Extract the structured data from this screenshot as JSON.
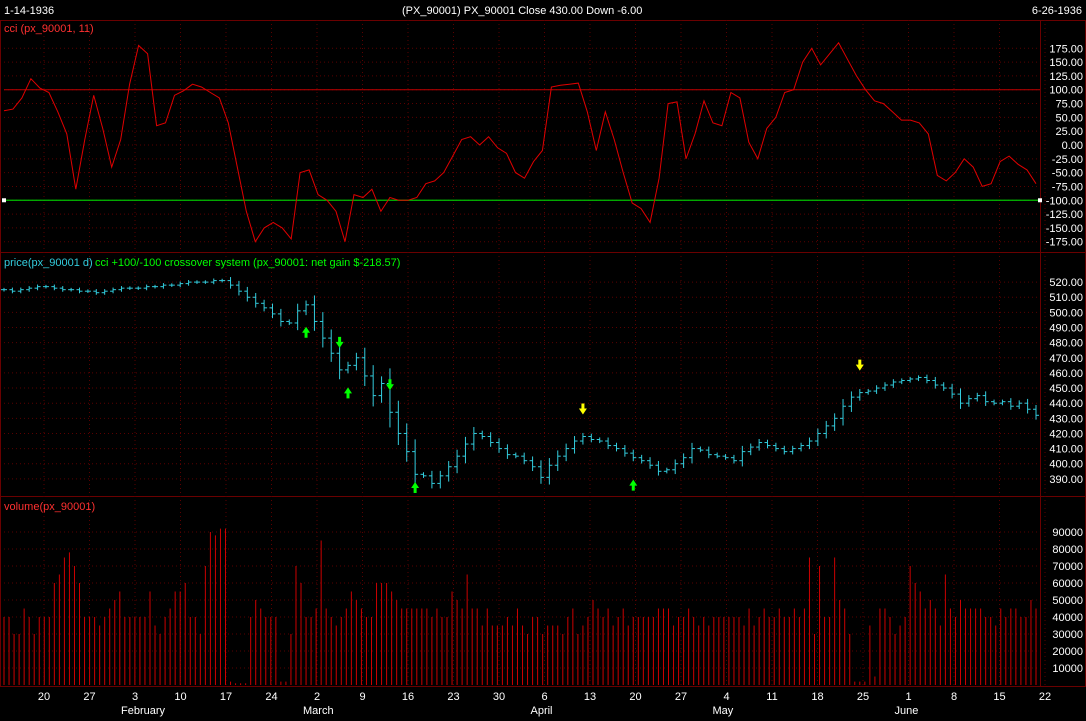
{
  "header": {
    "start_date": "1-14-1936",
    "title": "(PX_90001)  PX_90001   Close 430.00   Down -6.00",
    "end_date": "6-26-1936"
  },
  "colors": {
    "background": "#000000",
    "grid": "#5a0000",
    "cci_line": "#e00000",
    "cci_bands": "#c00000",
    "cci_threshold": "#00c000",
    "price_bars": "#33ccdd",
    "buy_arrow": "#00ff00",
    "sell_arrow": "#ffff00",
    "volume_bars": "#cc0000",
    "axis_text": "#ffffff",
    "cci_title": "#ff3030",
    "price_title": "#33ccdd",
    "system_title": "#00ff00",
    "volume_title": "#ff3030"
  },
  "chart_data": [
    {
      "type": "line",
      "panel": "cci",
      "title": "cci (px_90001, 11)",
      "ylim": [
        -190,
        190
      ],
      "y_ticks": [
        "175.00",
        "150.00",
        "125.00",
        "100.00",
        "75.00",
        "50.00",
        "25.00",
        "0.00",
        "-25.00",
        "-50.00",
        "-75.00",
        "-100.00",
        "-125.00",
        "-150.00",
        "-175.00"
      ],
      "reference_lines": {
        "upper": 100,
        "lower": -100
      },
      "values": [
        62,
        65,
        85,
        120,
        103,
        95,
        60,
        20,
        -80,
        10,
        90,
        30,
        -40,
        10,
        110,
        180,
        165,
        35,
        40,
        90,
        98,
        110,
        105,
        95,
        85,
        40,
        -40,
        -120,
        -175,
        -150,
        -140,
        -150,
        -170,
        -50,
        -45,
        -90,
        -100,
        -120,
        -175,
        -90,
        -95,
        -80,
        -120,
        -95,
        -100,
        -100,
        -95,
        -70,
        -65,
        -50,
        -20,
        10,
        15,
        0,
        15,
        -5,
        -15,
        -50,
        -60,
        -30,
        -10,
        105,
        108,
        110,
        112,
        60,
        -10,
        60,
        10,
        -50,
        -105,
        -115,
        -140,
        -60,
        75,
        78,
        -25,
        20,
        80,
        40,
        35,
        95,
        85,
        5,
        -25,
        30,
        50,
        95,
        100,
        150,
        175,
        145,
        165,
        185,
        155,
        125,
        100,
        80,
        75,
        60,
        45,
        45,
        40,
        20,
        -55,
        -65,
        -50,
        -25,
        -40,
        -75,
        -70,
        -30,
        -20,
        -35,
        -45,
        -70
      ]
    },
    {
      "type": "ohlc",
      "panel": "price",
      "title": "price(px_90001 d)",
      "system_label": "cci +100/-100 crossover system (px_90001: net gain $-218.57)",
      "ylim": [
        380,
        528
      ],
      "y_ticks": [
        "520.00",
        "510.00",
        "500.00",
        "490.00",
        "480.00",
        "470.00",
        "460.00",
        "450.00",
        "440.00",
        "430.00",
        "420.00",
        "410.00",
        "400.00",
        "390.00"
      ],
      "closes": [
        515,
        514,
        515,
        516,
        517,
        517,
        516,
        515,
        515,
        514,
        514,
        513,
        514,
        515,
        516,
        516,
        516,
        517,
        517,
        518,
        518,
        519,
        520,
        520,
        520,
        521,
        521,
        518,
        514,
        510,
        506,
        503,
        499,
        494,
        493,
        501,
        505,
        494,
        483,
        473,
        462,
        465,
        470,
        458,
        445,
        453,
        434,
        420,
        408,
        393,
        392,
        387,
        392,
        398,
        405,
        413,
        420,
        418,
        414,
        410,
        406,
        405,
        402,
        398,
        391,
        399,
        405,
        410,
        415,
        418,
        416,
        415,
        412,
        410,
        407,
        404,
        402,
        399,
        395,
        396,
        400,
        404,
        410,
        409,
        406,
        405,
        404,
        402,
        408,
        411,
        414,
        412,
        410,
        408,
        410,
        412,
        415,
        420,
        425,
        430,
        438,
        444,
        447,
        448,
        450,
        452,
        454,
        455,
        456,
        457,
        455,
        452,
        450,
        446,
        440,
        443,
        445,
        441,
        440,
        441,
        438,
        440,
        436,
        432
      ],
      "buy_signals": [
        36,
        41,
        49,
        75
      ],
      "sell_signals": [
        40,
        46,
        69,
        102
      ]
    },
    {
      "type": "bar",
      "panel": "volume",
      "title": "volume(px_90001)",
      "ylim": [
        0,
        100000
      ],
      "y_ticks": [
        "90000",
        "80000",
        "70000",
        "60000",
        "50000",
        "40000",
        "30000",
        "20000",
        "10000"
      ],
      "values": [
        40000,
        40000,
        30000,
        30000,
        45000,
        40000,
        30000,
        40000,
        40000,
        40000,
        60000,
        65000,
        75000,
        78000,
        70000,
        60000,
        40000,
        40000,
        40000,
        35000,
        40000,
        45000,
        50000,
        55000,
        40000,
        40000,
        40000,
        40000,
        40000,
        55000,
        35000,
        30000,
        40000,
        45000,
        55000,
        55000,
        60000,
        40000,
        40000,
        30000,
        70000,
        90000,
        88000,
        92000,
        92000,
        2000,
        1000,
        1000,
        1000,
        40000,
        50000,
        45000,
        40000,
        40000,
        40000,
        2000,
        2000,
        30000,
        70000,
        60000,
        40000,
        40000,
        45000,
        85000,
        45000,
        40000,
        35000,
        40000,
        45000,
        55000,
        50000,
        45000,
        40000,
        40000,
        60000,
        60000,
        60000,
        55000,
        50000,
        45000,
        45000,
        45000,
        45000,
        45000,
        45000,
        40000,
        45000,
        40000,
        40000,
        55000,
        50000,
        45000,
        65000,
        45000,
        45000,
        35000,
        45000,
        35000,
        35000,
        35000,
        40000,
        35000,
        45000,
        35000,
        30000,
        40000,
        40000,
        30000,
        35000,
        35000,
        35000,
        30000,
        40000,
        45000,
        30000,
        35000,
        40000,
        50000,
        45000,
        40000,
        45000,
        35000,
        40000,
        45000,
        35000,
        40000,
        40000,
        40000,
        40000,
        40000,
        45000,
        45000,
        45000,
        35000,
        40000,
        40000,
        45000,
        40000,
        35000,
        40000,
        35000,
        40000,
        40000,
        40000,
        40000,
        40000,
        40000,
        35000,
        45000,
        35000,
        40000,
        45000,
        40000,
        40000,
        45000,
        40000,
        40000,
        45000,
        40000,
        45000,
        75000,
        30000,
        70000,
        40000,
        40000,
        75000,
        50000,
        45000,
        30000,
        2000,
        2000,
        2000,
        35000,
        5000,
        45000,
        45000,
        40000,
        30000,
        35000,
        40000,
        70000,
        60000,
        55000,
        45000,
        50000,
        45000,
        35000,
        65000,
        45000,
        40000,
        50000,
        45000,
        45000,
        45000,
        45000,
        40000,
        40000,
        35000,
        45000,
        40000,
        45000,
        45000,
        40000,
        40000,
        50000,
        45000
      ]
    }
  ],
  "x_axis": {
    "day_labels": [
      "20",
      "27",
      "3",
      "10",
      "17",
      "24",
      "2",
      "9",
      "16",
      "23",
      "30",
      "6",
      "13",
      "20",
      "27",
      "4",
      "11",
      "18",
      "25",
      "1",
      "8",
      "15",
      "22"
    ],
    "month_labels": [
      "February",
      "March",
      "April",
      "May",
      "June"
    ]
  }
}
